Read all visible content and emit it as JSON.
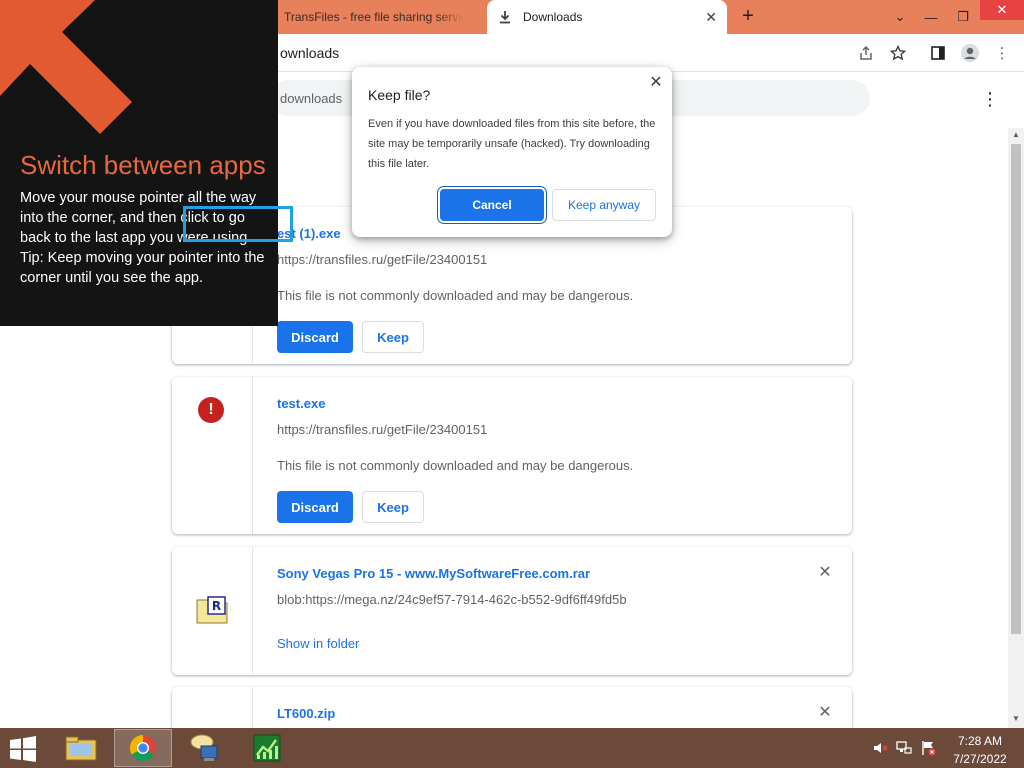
{
  "tabs": {
    "inactive_label": "TransFiles - free file sharing service",
    "active_label": "Downloads",
    "new_tab_symbol": "+",
    "close_symbol": "✕"
  },
  "window_controls": {
    "tab_search_symbol": "⌄",
    "minimize_symbol": "—",
    "maximize_symbol": "❐",
    "close_symbol": "✕"
  },
  "address_bar": {
    "url_text": "ownloads"
  },
  "downloads_page": {
    "search_placeholder": "downloads",
    "menu_symbol": "⋮"
  },
  "items": [
    {
      "name": "est (1).exe",
      "url": "https://transfiles.ru/getFile/23400151",
      "warning": "This file is not commonly downloaded and may be dangerous.",
      "discard_label": "Discard",
      "keep_label": "Keep"
    },
    {
      "name": "test.exe",
      "url": "https://transfiles.ru/getFile/23400151",
      "warning": "This file is not commonly downloaded and may be dangerous.",
      "discard_label": "Discard",
      "keep_label": "Keep",
      "icon": "danger-icon",
      "icon_symbol": "!"
    },
    {
      "name": "Sony Vegas Pro 15 - www.MySoftwareFree.com.rar",
      "url": "blob:https://mega.nz/24c9ef57-7914-462c-b552-9df6ff49fd5b",
      "action_label": "Show in folder",
      "icon": "rar-file-icon",
      "remove_symbol": "✕"
    },
    {
      "name": "LT600.zip",
      "remove_symbol": "✕"
    }
  ],
  "dialog": {
    "title": "Keep file?",
    "body": "Even if you have downloaded files from this site before, the site may be temporarily unsafe (hacked). Try downloading this file later.",
    "cancel_label": "Cancel",
    "keep_label": "Keep anyway",
    "close_symbol": "✕"
  },
  "tip": {
    "title": "Switch between apps",
    "line1": "Move your mouse pointer all the way into the corner, and then click to go back to the last app you were using.",
    "line2": "Tip: Keep moving your pointer into the corner until you see the app."
  },
  "taskbar": {
    "time": "7:28 AM",
    "date": "7/27/2022"
  },
  "colors": {
    "tab_strip": "#e8805c",
    "accent_blue": "#1a73e8",
    "danger_red": "#c5221f",
    "tip_title": "#e8683d",
    "tip_highlight": "#1ea3e0",
    "taskbar": "#6b4a3a"
  }
}
